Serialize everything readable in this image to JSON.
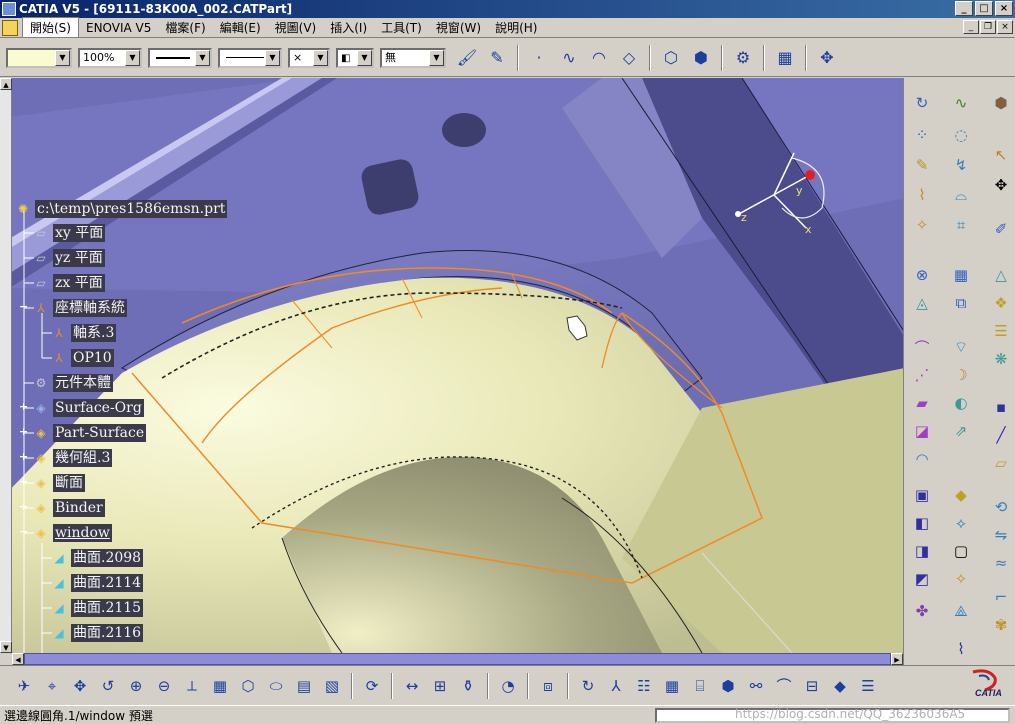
{
  "window": {
    "title": "CATIA V5 - [69111-83K00A_002.CATPart]",
    "buttons": {
      "minimize": "_",
      "maximize": "□",
      "close": "×"
    }
  },
  "menu": {
    "items": [
      "開始(S)",
      "ENOVIA V5",
      "檔案(F)",
      "編輯(E)",
      "視圖(V)",
      "插入(I)",
      "工具(T)",
      "視窗(W)",
      "說明(H)"
    ]
  },
  "properties_toolbar": {
    "color_value": "",
    "transparency_value": "100%",
    "line_thickness_value": "",
    "line_type_value": "",
    "point_symbol_value": "×",
    "layer_value": "",
    "layer_name_value": "無"
  },
  "tree": {
    "root": "c:\\temp\\pres1586emsn.prt",
    "nodes": [
      {
        "label": "xy 平面",
        "level": 1
      },
      {
        "label": "yz 平面",
        "level": 1
      },
      {
        "label": "zx 平面",
        "level": 1
      },
      {
        "label": "座標軸系統",
        "level": 1
      },
      {
        "label": "軸系.3",
        "level": 2
      },
      {
        "label": "OP10",
        "level": 2
      },
      {
        "label": "元件本體",
        "level": 1
      },
      {
        "label": "Surface-Org",
        "level": 1
      },
      {
        "label": "Part-Surface",
        "level": 1
      },
      {
        "label": "幾何組.3",
        "level": 1
      },
      {
        "label": "斷面",
        "level": 1
      },
      {
        "label": "Binder",
        "level": 1
      },
      {
        "label": "window",
        "level": 1
      },
      {
        "label": "曲面.2098",
        "level": 2
      },
      {
        "label": "曲面.2114",
        "level": 2
      },
      {
        "label": "曲面.2115",
        "level": 2
      },
      {
        "label": "曲面.2116",
        "level": 2
      }
    ]
  },
  "compass": {
    "x_label": "x",
    "y_label": "y",
    "z_label": "z"
  },
  "statusbar": {
    "message": "選邊線圓角.1/window 預選",
    "watermark": "https://blog.csdn.net/QQ_36236036A5"
  },
  "logo": {
    "text": "CATIA"
  },
  "colors": {
    "viewport_bg": "#6f6fb5",
    "surface_light": "#f4f2c4",
    "surface_dark": "#9c9c7a",
    "highlight": "#f08a24"
  }
}
